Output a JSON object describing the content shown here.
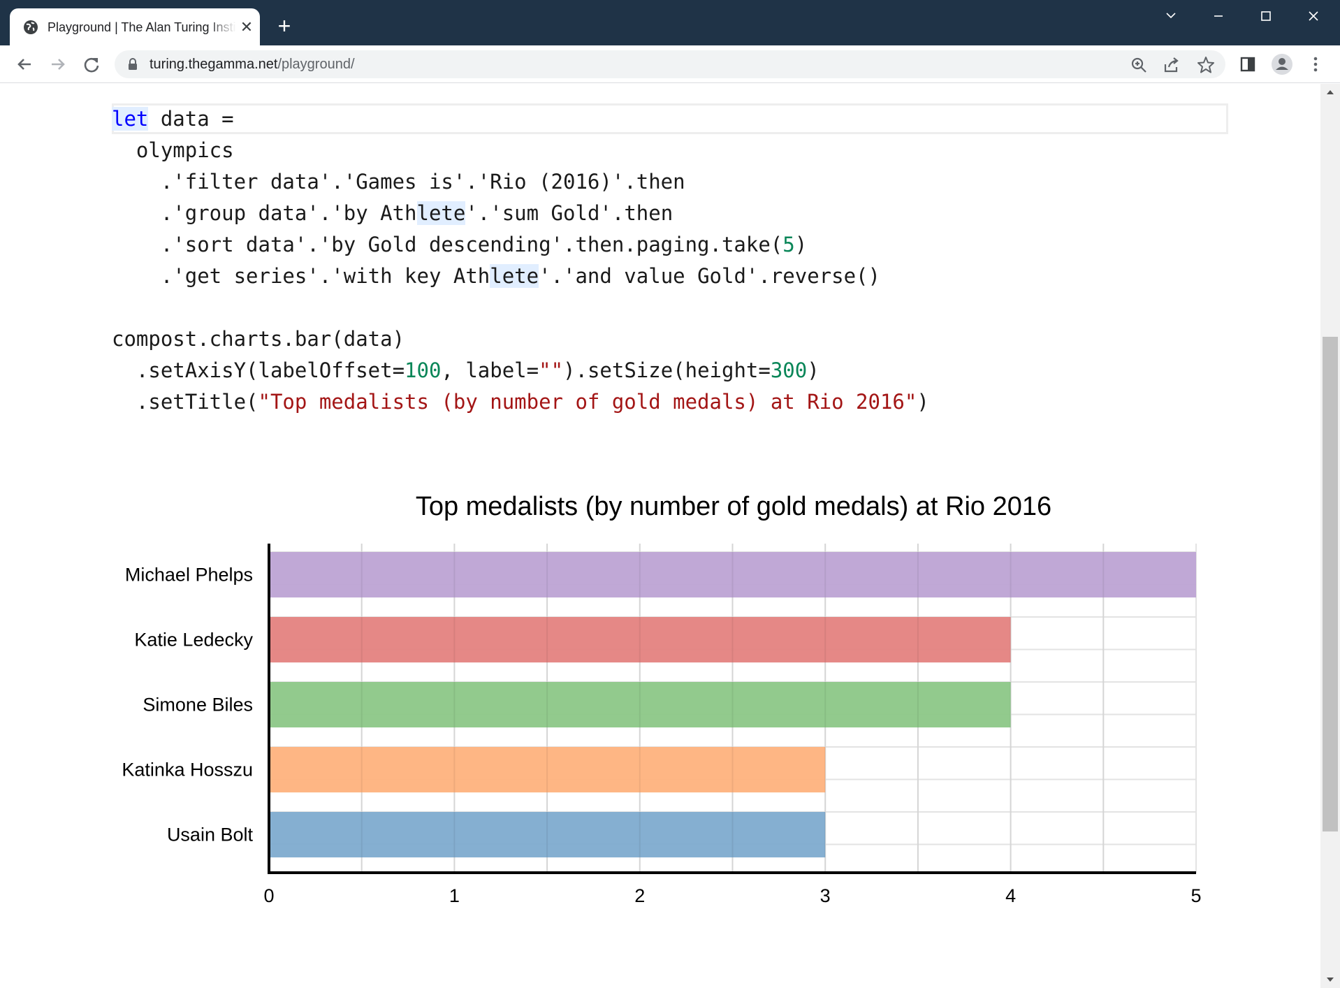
{
  "browser": {
    "tab_title": "Playground | The Alan Turing Institute",
    "url_domain": "turing.thegamma.net",
    "url_path": "/playground/"
  },
  "code": {
    "lines": [
      [
        {
          "t": "let",
          "c": "kw"
        },
        {
          "t": " data ="
        }
      ],
      [
        {
          "t": "  olympics"
        }
      ],
      [
        {
          "t": "    .'filter data'.'Games is'.'Rio (2016)'.then"
        }
      ],
      [
        {
          "t": "    .'group data'.'by Ath"
        },
        {
          "t": "lete",
          "c": "hl"
        },
        {
          "t": "'.'sum Gold'.then"
        }
      ],
      [
        {
          "t": "    .'sort data'.'by Gold descending'.then.paging.take("
        },
        {
          "t": "5",
          "c": "num"
        },
        {
          "t": ")"
        }
      ],
      [
        {
          "t": "    .'get series'.'with key Ath"
        },
        {
          "t": "lete",
          "c": "hl"
        },
        {
          "t": "'.'and value Gold'.reverse()"
        }
      ],
      [
        {
          "t": ""
        }
      ],
      [
        {
          "t": "compost.charts.bar(data)"
        }
      ],
      [
        {
          "t": "  .setAxisY(labelOffset="
        },
        {
          "t": "100",
          "c": "num"
        },
        {
          "t": ", label="
        },
        {
          "t": "\"\"",
          "c": "str"
        },
        {
          "t": ").setSize(height="
        },
        {
          "t": "300",
          "c": "num"
        },
        {
          "t": ")"
        }
      ],
      [
        {
          "t": "  .setTitle("
        },
        {
          "t": "\"Top medalists (by number of gold medals) at Rio 2016\"",
          "c": "str"
        },
        {
          "t": ")"
        }
      ]
    ]
  },
  "chart_data": {
    "type": "bar",
    "orientation": "horizontal",
    "title": "Top medalists (by number of gold medals) at Rio 2016",
    "xlabel": "",
    "ylabel": "",
    "xlim": [
      0,
      5
    ],
    "x_ticks": [
      0,
      1,
      2,
      3,
      4,
      5
    ],
    "grid": true,
    "categories": [
      "Michael Phelps",
      "Katie Ledecky",
      "Simone Biles",
      "Katinka Hosszu",
      "Usain Bolt"
    ],
    "values": [
      5,
      4,
      4,
      3,
      3
    ],
    "colors": [
      "#bda3d4",
      "#e48280",
      "#8cc787",
      "#feb27d",
      "#7eabcf"
    ]
  }
}
